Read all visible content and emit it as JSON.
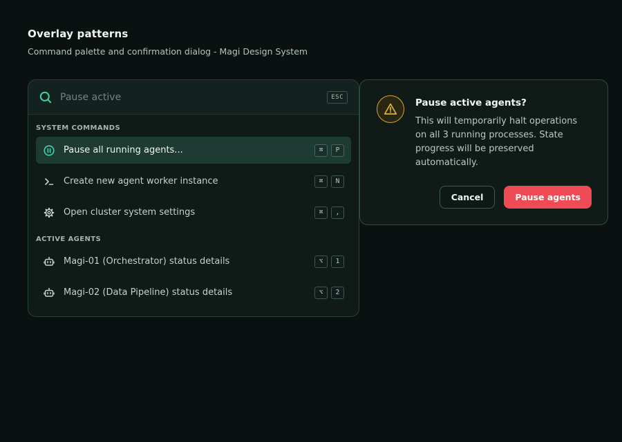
{
  "header": {
    "title": "Overlay patterns",
    "subtitle": "Command palette and confirmation dialog - Magi Design System"
  },
  "palette": {
    "search_placeholder": "Pause active",
    "esc_label": "ESC",
    "sections": [
      {
        "label": "SYSTEM COMMANDS",
        "items": [
          {
            "label": "Pause all running agents...",
            "icon": "pause-circle-icon",
            "keys": [
              "⌘",
              "P"
            ],
            "active": true
          },
          {
            "label": "Create new agent worker instance",
            "icon": "terminal-icon",
            "keys": [
              "⌘",
              "N"
            ],
            "active": false
          },
          {
            "label": "Open cluster system settings",
            "icon": "gear-icon",
            "keys": [
              "⌘",
              ","
            ],
            "active": false
          }
        ]
      },
      {
        "label": "ACTIVE AGENTS",
        "items": [
          {
            "label": "Magi-01 (Orchestrator) status details",
            "icon": "robot-icon",
            "keys": [
              "⌥",
              "1"
            ],
            "active": false
          },
          {
            "label": "Magi-02 (Data Pipeline) status details",
            "icon": "robot-icon",
            "keys": [
              "⌥",
              "2"
            ],
            "active": false
          }
        ]
      }
    ]
  },
  "dialog": {
    "title": "Pause active agents?",
    "message": "This will temporarily halt operations on all 3 running processes. State progress will be preserved automatically.",
    "cancel_label": "Cancel",
    "confirm_label": "Pause agents"
  },
  "colors": {
    "accent": "#3fd6a4",
    "danger": "#ef4b55",
    "warning": "#d9a62d",
    "background": "#0a1110"
  }
}
